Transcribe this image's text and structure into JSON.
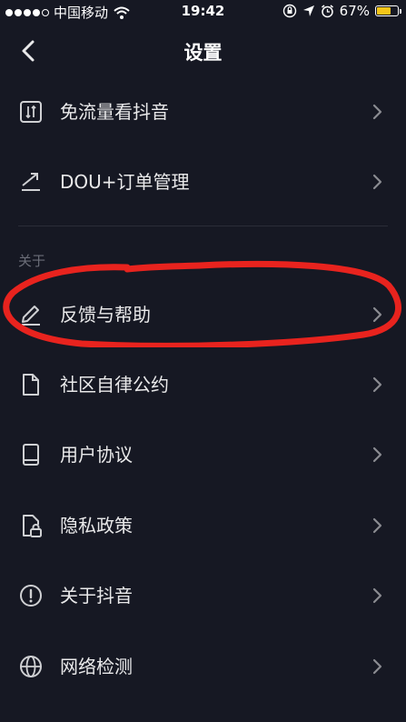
{
  "status_bar": {
    "carrier": "中国移动",
    "time": "19:42",
    "battery": "67%",
    "battery_level": 0.67
  },
  "nav": {
    "title": "设置",
    "back_icon": "chevron-left-icon"
  },
  "section_header": "关于",
  "items": [
    {
      "label": "免流量看抖音",
      "icon": "data-traffic-icon"
    },
    {
      "label": "DOU+订单管理",
      "icon": "trend-icon"
    },
    {
      "label": "反馈与帮助",
      "icon": "edit-icon"
    },
    {
      "label": "社区自律公约",
      "icon": "document-icon"
    },
    {
      "label": "用户协议",
      "icon": "book-icon"
    },
    {
      "label": "隐私政策",
      "icon": "privacy-lock-icon"
    },
    {
      "label": "关于抖音",
      "icon": "info-icon"
    },
    {
      "label": "网络检测",
      "icon": "globe-icon"
    }
  ],
  "colors": {
    "background": "#161823",
    "text": "#e9e9ea",
    "chevron": "#8a8b91",
    "annotation": "#e8231e"
  }
}
